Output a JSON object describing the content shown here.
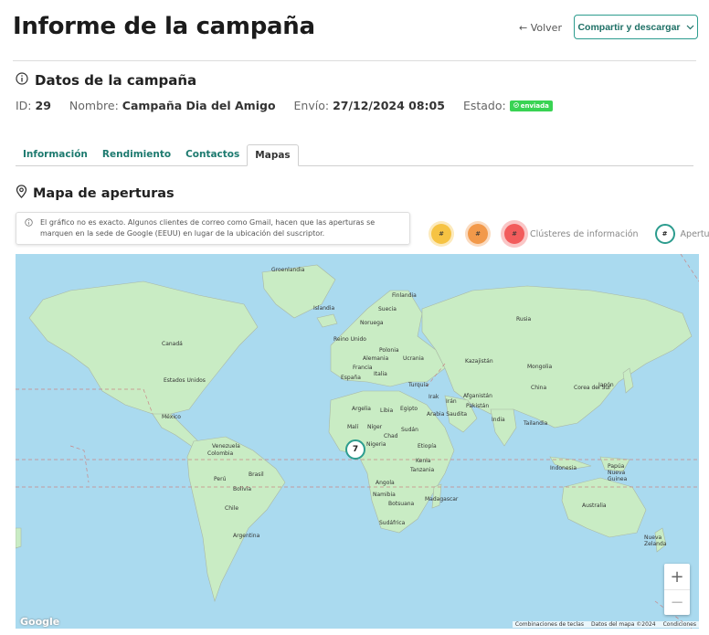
{
  "header": {
    "title": "Informe de la campaña",
    "back_label": "← Volver",
    "share_label": "Compartir y descargar"
  },
  "campaign": {
    "section_title": "Datos de la campaña",
    "id_label": "ID:",
    "id_value": "29",
    "name_label": "Nombre:",
    "name_value": "Campaña Dia del Amigo",
    "send_label": "Envío:",
    "send_value": "27/12/2024 08:05",
    "status_label": "Estado:",
    "status_value": "enviada",
    "status_color": "#39d353"
  },
  "tabs": [
    {
      "label": "Información",
      "active": false
    },
    {
      "label": "Rendimiento",
      "active": false
    },
    {
      "label": "Contactos",
      "active": false
    },
    {
      "label": "Mapas",
      "active": true
    }
  ],
  "map_section": {
    "title": "Mapa de aperturas",
    "note": "El gráfico no es exacto. Algunos clientes de correo como Gmail, hacen que las aperturas se marquen en la sede de Google (EEUU) en lugar de la ubicación del suscriptor.",
    "legend": {
      "cluster_symbol": "#",
      "clusters_label": "Clústeres de información",
      "opens_label": "Aperturas"
    },
    "cluster_count": "7",
    "zoom_in": "+",
    "zoom_out": "−",
    "google_logo": "Google",
    "attribution": [
      "Combinaciones de teclas",
      "Datos del mapa ©2024",
      "Condiciones"
    ],
    "countries": {
      "groenlandia": "Groenlandia",
      "islandia": "Islandia",
      "finlandia": "Finlandia",
      "suecia": "Suecia",
      "noruega": "Noruega",
      "rusia": "Rusia",
      "canada": "Canadá",
      "reino_unido": "Reino Unido",
      "polonia": "Polonia",
      "alemania": "Alemania",
      "ucrania": "Ucrania",
      "francia": "Francia",
      "italia": "Italia",
      "espana": "España",
      "kazajistan": "Kazajistán",
      "mongolia": "Mongolia",
      "estados_unidos": "Estados Unidos",
      "turquia": "Turquía",
      "china": "China",
      "corea": "Corea del Sur",
      "japon": "Japón",
      "afganistan": "Afganistán",
      "irak": "Irak",
      "iran": "Irán",
      "pakistan": "Pakistán",
      "mexico": "México",
      "argelia": "Argelia",
      "libia": "Libia",
      "egipto": "Egipto",
      "arabia": "Arabia Saudita",
      "india": "India",
      "tailandia": "Tailandia",
      "mali": "Malí",
      "niger": "Níger",
      "sudan": "Sudán",
      "chad": "Chad",
      "venezuela": "Venezuela",
      "nigeria": "Nigeria",
      "etiopia": "Etiopía",
      "colombia": "Colombia",
      "kenia": "Kenia",
      "tanzania": "Tanzania",
      "indonesia": "Indonesia",
      "papua": "Papúa Nueva Guinea",
      "peru": "Perú",
      "brasil": "Brasil",
      "angola": "Angola",
      "bolivia": "Bolivia",
      "namibia": "Namibia",
      "madagascar": "Madagascar",
      "botsuana": "Botsuana",
      "australia": "Australia",
      "chile": "Chile",
      "sudafrica": "Sudáfrica",
      "argentina": "Argentina",
      "nueva_zelanda": "Nueva Zelanda"
    }
  }
}
